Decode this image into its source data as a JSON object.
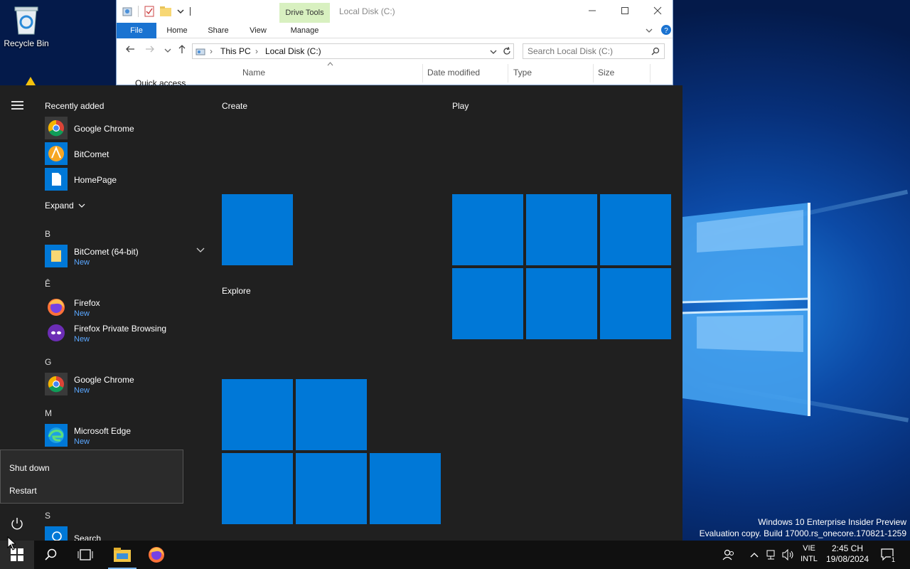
{
  "desktop": {
    "recycle_bin_label": "Recycle Bin"
  },
  "explorer": {
    "drive_tools_label": "Drive Tools",
    "window_title": "Local Disk (C:)",
    "ribbon_tabs": [
      "File",
      "Home",
      "Share",
      "View",
      "Manage"
    ],
    "breadcrumb": [
      "This PC",
      "Local Disk (C:)"
    ],
    "search_placeholder": "Search Local Disk (C:)",
    "columns": [
      "Name",
      "Date modified",
      "Type",
      "Size"
    ],
    "quick_access_label": "Quick access"
  },
  "start_menu": {
    "recently_added_label": "Recently added",
    "recent_apps": [
      "Google Chrome",
      "BitComet",
      "HomePage"
    ],
    "expand_label": "Expand",
    "letters": [
      "B",
      "Ê",
      "G",
      "M",
      "S"
    ],
    "apps": [
      {
        "name": "BitComet (64-bit)",
        "sub": "New"
      },
      {
        "name": "Firefox",
        "sub": "New"
      },
      {
        "name": "Firefox Private Browsing",
        "sub": "New"
      },
      {
        "name": "Google Chrome",
        "sub": "New"
      },
      {
        "name": "Microsoft Edge",
        "sub": "New"
      },
      {
        "name": "Search",
        "sub": ""
      }
    ],
    "groups": [
      "Create",
      "Play",
      "Explore"
    ],
    "power_menu": [
      "Shut down",
      "Restart"
    ]
  },
  "watermark": {
    "line1": "Windows 10 Enterprise Insider Preview",
    "line2": "Evaluation copy. Build 17000.rs_onecore.170821-1259"
  },
  "taskbar": {
    "lang_line1": "VIE",
    "lang_line2": "INTL",
    "time": "2:45 CH",
    "date": "19/08/2024",
    "notification_count": "1"
  },
  "colors": {
    "tile_blue": "#0078d7",
    "start_bg": "#202020",
    "accent_new": "#5aa7ff",
    "drive_tools_bg": "#d8f0c0"
  }
}
